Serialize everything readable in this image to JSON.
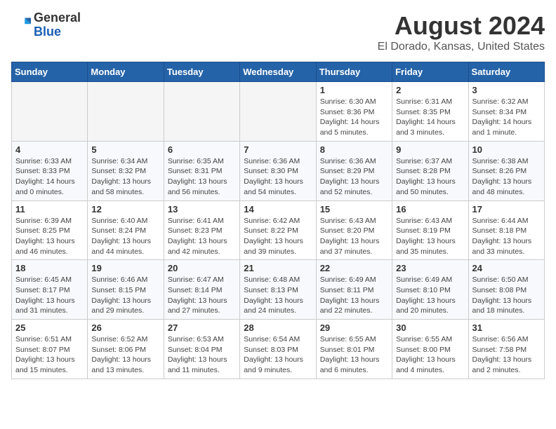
{
  "header": {
    "logo_line1": "General",
    "logo_line2": "Blue",
    "title": "August 2024",
    "subtitle": "El Dorado, Kansas, United States"
  },
  "weekdays": [
    "Sunday",
    "Monday",
    "Tuesday",
    "Wednesday",
    "Thursday",
    "Friday",
    "Saturday"
  ],
  "weeks": [
    [
      {
        "day": "",
        "info": ""
      },
      {
        "day": "",
        "info": ""
      },
      {
        "day": "",
        "info": ""
      },
      {
        "day": "",
        "info": ""
      },
      {
        "day": "1",
        "info": "Sunrise: 6:30 AM\nSunset: 8:36 PM\nDaylight: 14 hours\nand 5 minutes."
      },
      {
        "day": "2",
        "info": "Sunrise: 6:31 AM\nSunset: 8:35 PM\nDaylight: 14 hours\nand 3 minutes."
      },
      {
        "day": "3",
        "info": "Sunrise: 6:32 AM\nSunset: 8:34 PM\nDaylight: 14 hours\nand 1 minute."
      }
    ],
    [
      {
        "day": "4",
        "info": "Sunrise: 6:33 AM\nSunset: 8:33 PM\nDaylight: 14 hours\nand 0 minutes."
      },
      {
        "day": "5",
        "info": "Sunrise: 6:34 AM\nSunset: 8:32 PM\nDaylight: 13 hours\nand 58 minutes."
      },
      {
        "day": "6",
        "info": "Sunrise: 6:35 AM\nSunset: 8:31 PM\nDaylight: 13 hours\nand 56 minutes."
      },
      {
        "day": "7",
        "info": "Sunrise: 6:36 AM\nSunset: 8:30 PM\nDaylight: 13 hours\nand 54 minutes."
      },
      {
        "day": "8",
        "info": "Sunrise: 6:36 AM\nSunset: 8:29 PM\nDaylight: 13 hours\nand 52 minutes."
      },
      {
        "day": "9",
        "info": "Sunrise: 6:37 AM\nSunset: 8:28 PM\nDaylight: 13 hours\nand 50 minutes."
      },
      {
        "day": "10",
        "info": "Sunrise: 6:38 AM\nSunset: 8:26 PM\nDaylight: 13 hours\nand 48 minutes."
      }
    ],
    [
      {
        "day": "11",
        "info": "Sunrise: 6:39 AM\nSunset: 8:25 PM\nDaylight: 13 hours\nand 46 minutes."
      },
      {
        "day": "12",
        "info": "Sunrise: 6:40 AM\nSunset: 8:24 PM\nDaylight: 13 hours\nand 44 minutes."
      },
      {
        "day": "13",
        "info": "Sunrise: 6:41 AM\nSunset: 8:23 PM\nDaylight: 13 hours\nand 42 minutes."
      },
      {
        "day": "14",
        "info": "Sunrise: 6:42 AM\nSunset: 8:22 PM\nDaylight: 13 hours\nand 39 minutes."
      },
      {
        "day": "15",
        "info": "Sunrise: 6:43 AM\nSunset: 8:20 PM\nDaylight: 13 hours\nand 37 minutes."
      },
      {
        "day": "16",
        "info": "Sunrise: 6:43 AM\nSunset: 8:19 PM\nDaylight: 13 hours\nand 35 minutes."
      },
      {
        "day": "17",
        "info": "Sunrise: 6:44 AM\nSunset: 8:18 PM\nDaylight: 13 hours\nand 33 minutes."
      }
    ],
    [
      {
        "day": "18",
        "info": "Sunrise: 6:45 AM\nSunset: 8:17 PM\nDaylight: 13 hours\nand 31 minutes."
      },
      {
        "day": "19",
        "info": "Sunrise: 6:46 AM\nSunset: 8:15 PM\nDaylight: 13 hours\nand 29 minutes."
      },
      {
        "day": "20",
        "info": "Sunrise: 6:47 AM\nSunset: 8:14 PM\nDaylight: 13 hours\nand 27 minutes."
      },
      {
        "day": "21",
        "info": "Sunrise: 6:48 AM\nSunset: 8:13 PM\nDaylight: 13 hours\nand 24 minutes."
      },
      {
        "day": "22",
        "info": "Sunrise: 6:49 AM\nSunset: 8:11 PM\nDaylight: 13 hours\nand 22 minutes."
      },
      {
        "day": "23",
        "info": "Sunrise: 6:49 AM\nSunset: 8:10 PM\nDaylight: 13 hours\nand 20 minutes."
      },
      {
        "day": "24",
        "info": "Sunrise: 6:50 AM\nSunset: 8:08 PM\nDaylight: 13 hours\nand 18 minutes."
      }
    ],
    [
      {
        "day": "25",
        "info": "Sunrise: 6:51 AM\nSunset: 8:07 PM\nDaylight: 13 hours\nand 15 minutes."
      },
      {
        "day": "26",
        "info": "Sunrise: 6:52 AM\nSunset: 8:06 PM\nDaylight: 13 hours\nand 13 minutes."
      },
      {
        "day": "27",
        "info": "Sunrise: 6:53 AM\nSunset: 8:04 PM\nDaylight: 13 hours\nand 11 minutes."
      },
      {
        "day": "28",
        "info": "Sunrise: 6:54 AM\nSunset: 8:03 PM\nDaylight: 13 hours\nand 9 minutes."
      },
      {
        "day": "29",
        "info": "Sunrise: 6:55 AM\nSunset: 8:01 PM\nDaylight: 13 hours\nand 6 minutes."
      },
      {
        "day": "30",
        "info": "Sunrise: 6:55 AM\nSunset: 8:00 PM\nDaylight: 13 hours\nand 4 minutes."
      },
      {
        "day": "31",
        "info": "Sunrise: 6:56 AM\nSunset: 7:58 PM\nDaylight: 13 hours\nand 2 minutes."
      }
    ]
  ]
}
